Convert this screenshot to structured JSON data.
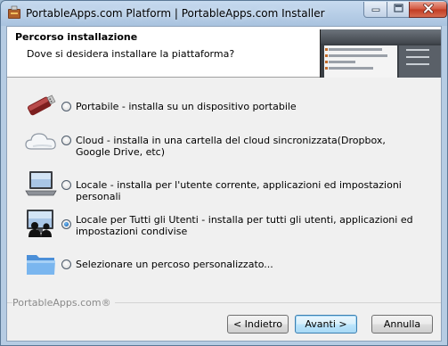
{
  "window": {
    "title": "PortableApps.com Platform | PortableApps.com Installer",
    "app_icon": "portableapps-installer-icon",
    "caption_buttons": [
      "minimize-icon",
      "maximize-icon",
      "close-icon"
    ]
  },
  "header": {
    "title": "Percorso installazione",
    "subtitle": "Dove si desidera installare la piattaforma?"
  },
  "options": [
    {
      "label": "Portabile - installa su un dispositivo portabile",
      "icon": "usb-drive-icon",
      "selected": false
    },
    {
      "label": "Cloud - installa in una cartella del cloud sincronizzata(Dropbox, Google Drive, etc)",
      "icon": "cloud-icon",
      "selected": false
    },
    {
      "label": "Locale - installa per l'utente corrente, applicazioni ed impostazioni personali",
      "icon": "laptop-icon",
      "selected": false
    },
    {
      "label": "Locale per Tutti gli Utenti - installa per tutti gli utenti, applicazioni ed impostazioni condivise",
      "icon": "computer-users-icon",
      "selected": true
    },
    {
      "label": "Selezionare un percoso personalizzato...",
      "icon": "folder-icon",
      "selected": false
    }
  ],
  "footer": {
    "brand": "PortableApps.com®",
    "back_label": "< Indietro",
    "next_label": "Avanti >",
    "cancel_label": "Annulla"
  },
  "colors": {
    "title_bar": "#a9c3df",
    "client_bg": "#f0f0f0",
    "header_bg": "#ffffff",
    "close_button": "#c13b22",
    "default_button": "#bee6fd"
  }
}
